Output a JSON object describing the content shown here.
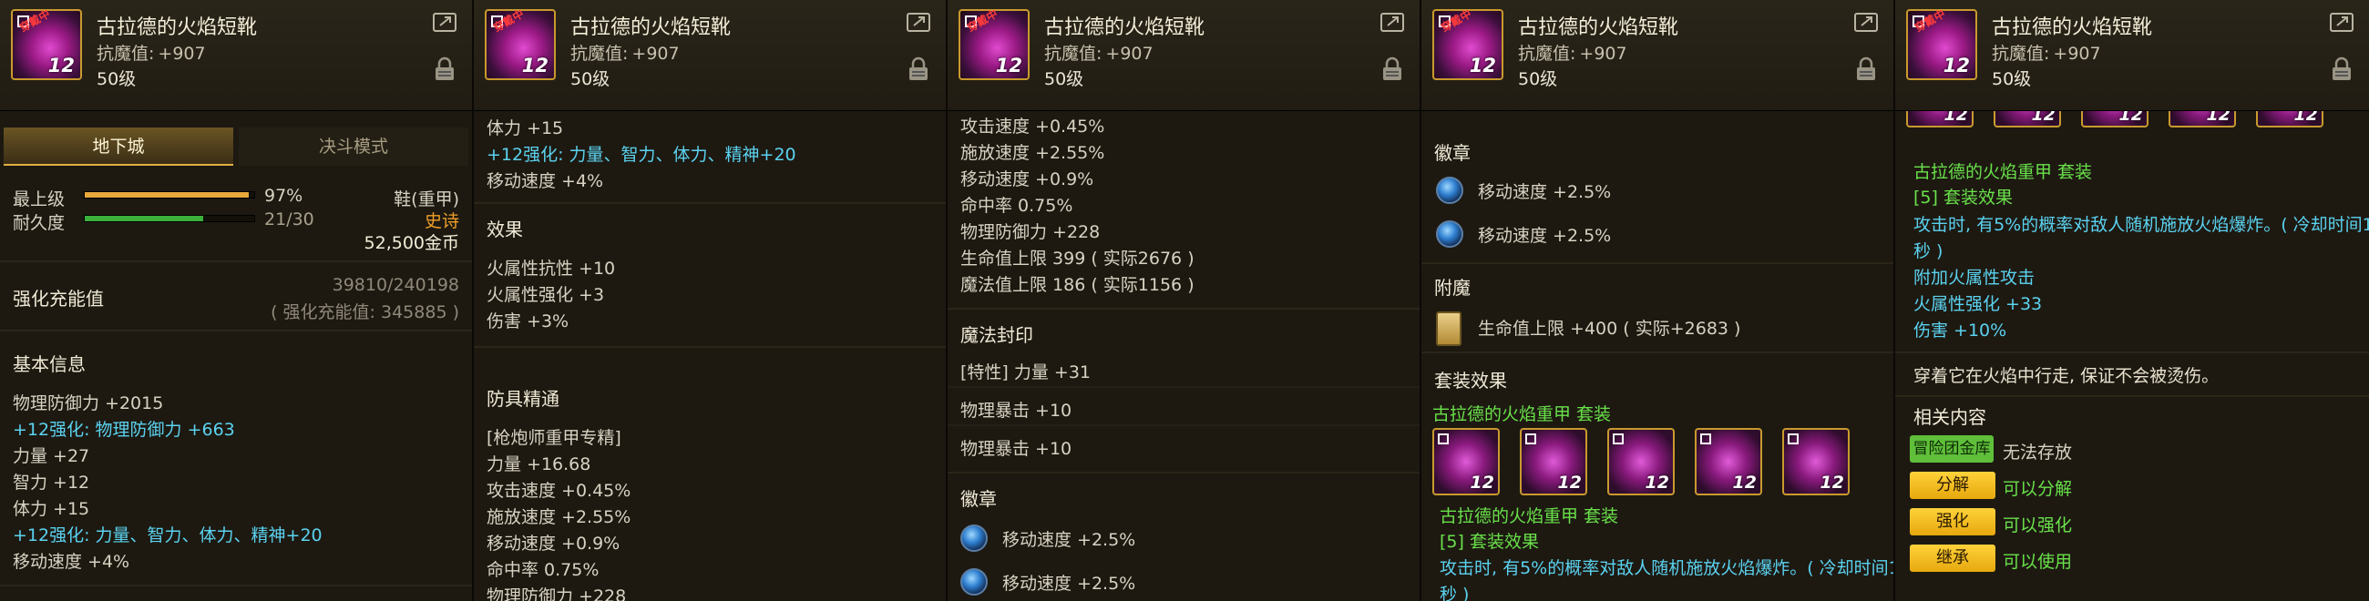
{
  "header": {
    "item_name": "古拉德的火焰短靴",
    "stat_label": "抗魔值:",
    "stat_value": "+907",
    "level": "50级",
    "icon_level": "12",
    "wear_tag": "穿戴中"
  },
  "panel1": {
    "tab_dungeon": "地下城",
    "tab_duel": "决斗模式",
    "quality_label": "最上级",
    "quality_value": "97%",
    "quality_fraction": 0.97,
    "durability_label": "耐久度",
    "durability_value": "21/30",
    "durability_fraction": 0.7,
    "type": "鞋(重甲)",
    "rarity": "史诗",
    "price": "52,500金币",
    "enhance_title": "强化充能值",
    "enhance_value": "39810/240198",
    "enhance_sub": "( 强化充能值: 345885 )",
    "basic_title": "基本信息",
    "lines": [
      "物理防御力 +2015",
      "+12强化: 物理防御力 +663",
      "力量 +27",
      "智力 +12",
      "体力 +15",
      "+12强化: 力量、智力、体力、精神+20",
      "移动速度 +4%"
    ]
  },
  "panel2": {
    "lines_top": [
      "体力 +15",
      "+12强化: 力量、智力、体力、精神+20",
      "移动速度 +4%"
    ],
    "effect_title": "效果",
    "effect_lines": [
      "火属性抗性 +10",
      "火属性强化 +3",
      "伤害 +3%"
    ],
    "mastery_title": "防具精通",
    "mastery_lines": [
      "[枪炮师重甲专精]",
      "力量 +16.68",
      "攻击速度 +0.45%",
      "施放速度 +2.55%",
      "移动速度 +0.9%",
      "命中率 0.75%",
      "物理防御力 +228"
    ]
  },
  "panel3": {
    "lines_top": [
      "攻击速度 +0.45%",
      "施放速度 +2.55%",
      "移动速度 +0.9%",
      "命中率 0.75%",
      "物理防御力 +228",
      "生命值上限 399 ( 实际2676 )",
      "魔法值上限 186 ( 实际1156 )"
    ],
    "seal_title": "魔法封印",
    "seal_lines": [
      "[特性] 力量 +31",
      "物理暴击 +10",
      "物理暴击 +10"
    ],
    "emblem_title": "徽章",
    "emblem_lines": [
      "移动速度 +2.5%",
      "移动速度 +2.5%"
    ]
  },
  "panel4": {
    "emblem_title": "徽章",
    "emblem_lines": [
      "移动速度 +2.5%",
      "移动速度 +2.5%"
    ],
    "enchant_title": "附魔",
    "enchant_line": "生命值上限 +400 ( 实际+2683 )",
    "set_title": "套装效果",
    "set_name": "古拉德的火焰重甲 套装",
    "set_name2": "古拉德的火焰重甲 套装",
    "set_effect": "[5] 套装效果",
    "set_desc": "攻击时, 有5%的概率对敌人随机施放火焰爆炸。( 冷却时间1",
    "set_desc2": "秒 )"
  },
  "panel5": {
    "set_name": "古拉德的火焰重甲 套装",
    "set_effect": "[5] 套装效果",
    "set_desc": "攻击时, 有5%的概率对敌人随机施放火焰爆炸。( 冷却时间1",
    "set_desc2": "秒 )",
    "bonus_lines": [
      "附加火属性攻击",
      "火属性强化 +33",
      "伤害 +10%"
    ],
    "flavor": "穿着它在火焰中行走, 保证不会被烫伤。",
    "related_title": "相关内容",
    "storage_badge": "冒险团金库",
    "storage_text": "无法存放",
    "actions": [
      {
        "label": "分解",
        "text": "可以分解"
      },
      {
        "label": "强化",
        "text": "可以强化"
      },
      {
        "label": "继承",
        "text": "可以使用"
      }
    ]
  },
  "colors": {
    "cyan": "#5bd2f0",
    "green": "#69e14a",
    "orange": "#f0a028",
    "gold": "#c99a2e"
  }
}
